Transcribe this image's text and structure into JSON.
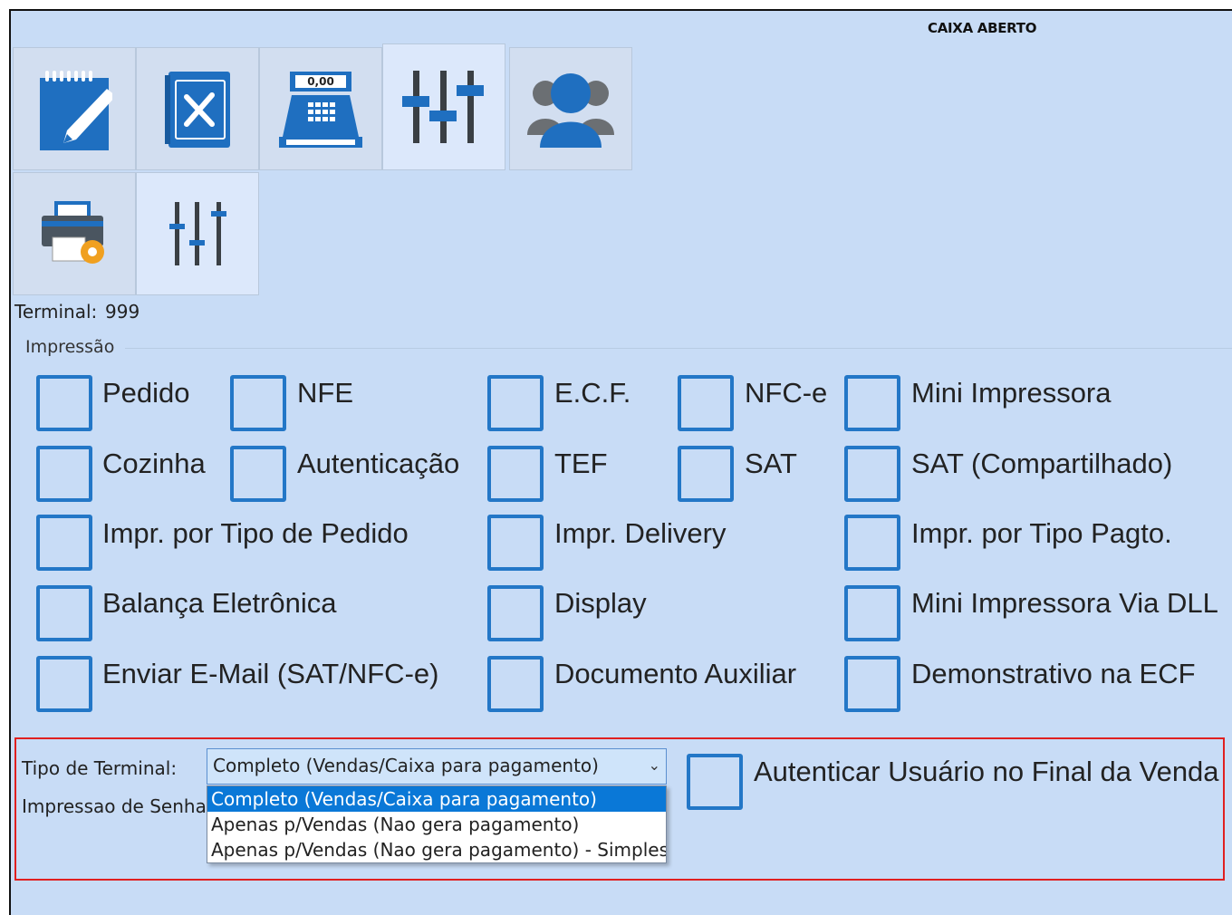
{
  "header": {
    "status": "CAIXA ABERTO"
  },
  "tabs": [
    {
      "name": "tab-pedidos",
      "icon": "notepad-pencil-icon"
    },
    {
      "name": "tab-cardapio",
      "icon": "menu-book-icon"
    },
    {
      "name": "tab-caixa",
      "icon": "cash-register-icon",
      "display": "0,00"
    },
    {
      "name": "tab-configuracoes",
      "icon": "sliders-icon",
      "active": true
    },
    {
      "name": "tab-usuarios",
      "icon": "users-icon"
    },
    {
      "name": "tab-impressao",
      "icon": "printer-gear-icon"
    },
    {
      "name": "tab-ajustes",
      "icon": "sliders-small-icon"
    }
  ],
  "terminal": {
    "label": "Terminal:",
    "value": "999"
  },
  "impressao": {
    "group_label": "Impressão",
    "options": [
      "Pedido",
      "NFE",
      "E.C.F.",
      "NFC-e",
      "Mini Impressora",
      "Cozinha",
      "Autenticação",
      "TEF",
      "SAT",
      "SAT (Compartilhado)",
      "Impr. por Tipo de Pedido",
      "Impr. Delivery",
      "Impr. por Tipo Pagto.",
      "Balança Eletrônica",
      "Display",
      "Mini Impressora Via DLL",
      "Enviar E-Mail (SAT/NFC-e)",
      "Documento Auxiliar",
      "Demonstrativo na ECF"
    ]
  },
  "terminal_config": {
    "tipo_label": "Tipo de Terminal:",
    "senha_label": "Impressao de Senha:",
    "tipo_value": "Completo (Vendas/Caixa para pagamento)",
    "tipo_options": [
      "Completo (Vendas/Caixa para pagamento)",
      "Apenas p/Vendas (Nao gera pagamento)",
      "Apenas p/Vendas (Nao gera pagamento) - Simples"
    ],
    "autenticar_label": "Autenticar Usuário no Final da Venda"
  },
  "colors": {
    "accent": "#2377c7",
    "background": "#c8dcf6",
    "highlight": "#e02020",
    "selected": "#0a78d7"
  }
}
